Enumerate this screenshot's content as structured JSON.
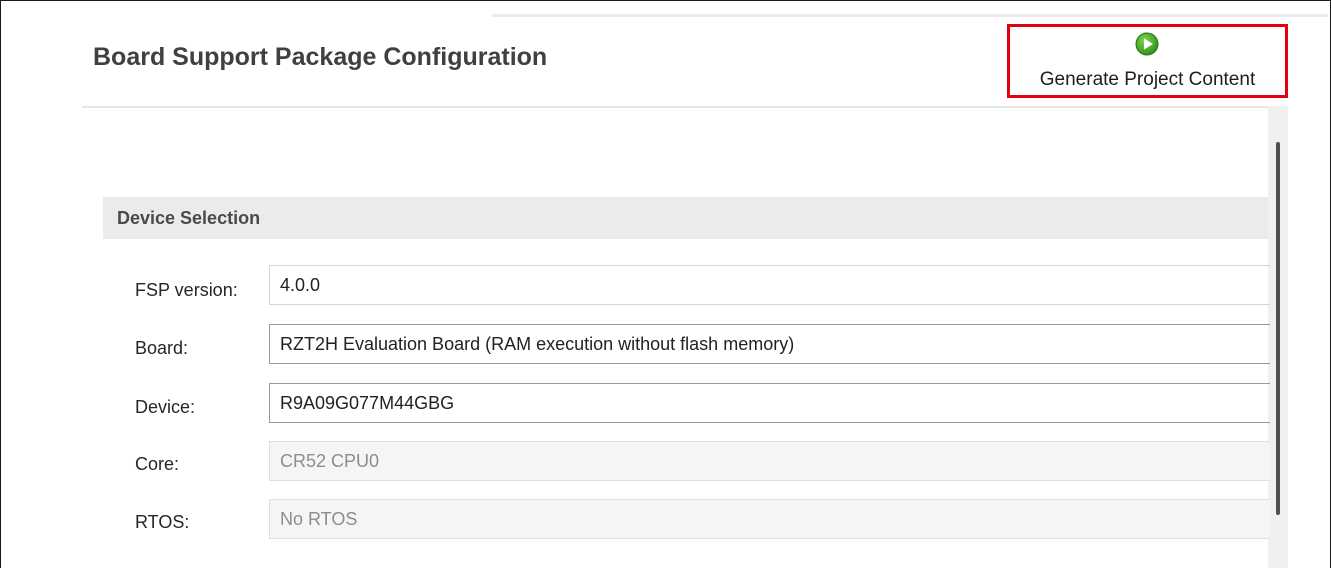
{
  "header": {
    "title": "Board Support Package Configuration",
    "generate_button": {
      "label": "Generate Project Content",
      "icon": "play-circle-icon",
      "icon_color": "#3aa11c",
      "highlight_color": "#e3000f"
    }
  },
  "device_selection": {
    "section_title": "Device Selection",
    "fields": [
      {
        "label": "FSP version:",
        "value": "4.0.0",
        "editable": true
      },
      {
        "label": "Board:",
        "value": "RZT2H Evaluation Board (RAM execution without flash memory)",
        "editable": true
      },
      {
        "label": "Device:",
        "value": "R9A09G077M44GBG",
        "editable": true
      },
      {
        "label": "Core:",
        "value": "CR52 CPU0",
        "editable": false
      },
      {
        "label": "RTOS:",
        "value": "No RTOS",
        "editable": false
      }
    ]
  }
}
